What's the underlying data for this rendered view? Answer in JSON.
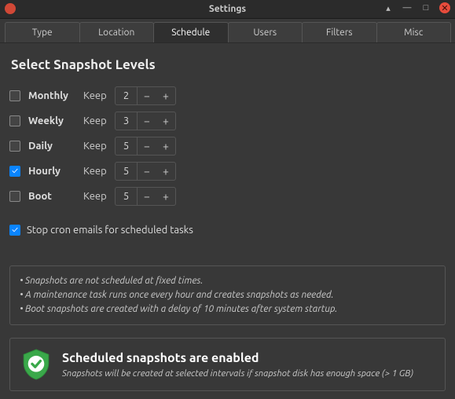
{
  "window": {
    "title": "Settings"
  },
  "tabs": [
    {
      "label": "Type"
    },
    {
      "label": "Location"
    },
    {
      "label": "Schedule"
    },
    {
      "label": "Users"
    },
    {
      "label": "Filters"
    },
    {
      "label": "Misc"
    }
  ],
  "active_tab": 2,
  "heading": "Select Snapshot Levels",
  "keep_label": "Keep",
  "levels": [
    {
      "name": "Monthly",
      "checked": false,
      "value": "2"
    },
    {
      "name": "Weekly",
      "checked": false,
      "value": "3"
    },
    {
      "name": "Daily",
      "checked": false,
      "value": "5"
    },
    {
      "name": "Hourly",
      "checked": true,
      "value": "5"
    },
    {
      "name": "Boot",
      "checked": false,
      "value": "5"
    }
  ],
  "cron": {
    "checked": true,
    "label": "Stop cron emails for scheduled tasks"
  },
  "info": {
    "line1": "• Snapshots are not scheduled at fixed times.",
    "line2": "• A maintenance task runs once every hour and creates snapshots as needed.",
    "line3": "• Boot snapshots are created with a delay of 10 minutes after system startup."
  },
  "status": {
    "title": "Scheduled snapshots are enabled",
    "subtitle": "Snapshots will be created at selected intervals if snapshot disk has enough space (> 1 GB)"
  }
}
